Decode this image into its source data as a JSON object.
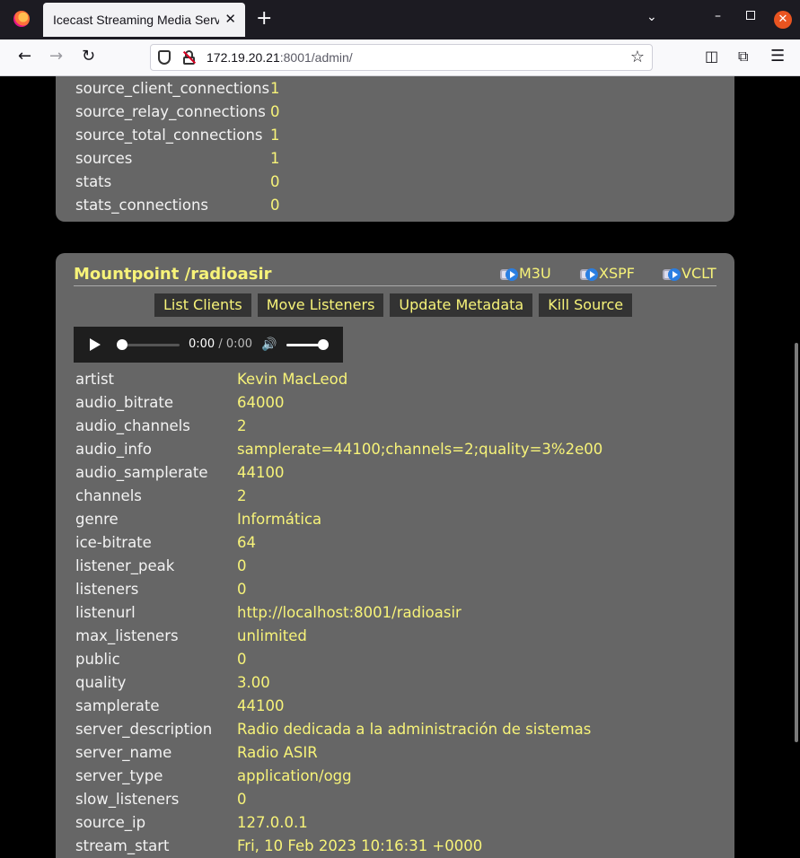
{
  "browser": {
    "tab_title": "Icecast Streaming Media Server",
    "tab_close": "✕",
    "new_tab": "+",
    "url_host": "172.19.20.21",
    "url_rest": ":8001/admin/"
  },
  "global_stats": [
    {
      "key": "source_client_connections",
      "value": "1"
    },
    {
      "key": "source_relay_connections",
      "value": "0"
    },
    {
      "key": "source_total_connections",
      "value": "1"
    },
    {
      "key": "sources",
      "value": "1"
    },
    {
      "key": "stats",
      "value": "0"
    },
    {
      "key": "stats_connections",
      "value": "0"
    }
  ],
  "mountpoint": {
    "title": "Mountpoint /radioasir",
    "playlists": [
      "M3U",
      "XSPF",
      "VCLT"
    ],
    "actions": [
      "List Clients",
      "Move Listeners",
      "Update Metadata",
      "Kill Source"
    ],
    "player": {
      "current": "0:00",
      "separator": " / ",
      "duration": "0:00"
    },
    "stats": [
      {
        "key": "artist",
        "value": "Kevin MacLeod"
      },
      {
        "key": "audio_bitrate",
        "value": "64000"
      },
      {
        "key": "audio_channels",
        "value": "2"
      },
      {
        "key": "audio_info",
        "value": "samplerate=44100;channels=2;quality=3%2e00"
      },
      {
        "key": "audio_samplerate",
        "value": "44100"
      },
      {
        "key": "channels",
        "value": "2"
      },
      {
        "key": "genre",
        "value": "Informática"
      },
      {
        "key": "ice-bitrate",
        "value": "64"
      },
      {
        "key": "listener_peak",
        "value": "0"
      },
      {
        "key": "listeners",
        "value": "0"
      },
      {
        "key": "listenurl",
        "value": "http://localhost:8001/radioasir"
      },
      {
        "key": "max_listeners",
        "value": "unlimited"
      },
      {
        "key": "public",
        "value": "0"
      },
      {
        "key": "quality",
        "value": "3.00"
      },
      {
        "key": "samplerate",
        "value": "44100"
      },
      {
        "key": "server_description",
        "value": "Radio dedicada a la administración de sistemas"
      },
      {
        "key": "server_name",
        "value": "Radio ASIR"
      },
      {
        "key": "server_type",
        "value": "application/ogg"
      },
      {
        "key": "slow_listeners",
        "value": "0"
      },
      {
        "key": "source_ip",
        "value": "127.0.0.1"
      },
      {
        "key": "stream_start",
        "value": "Fri, 10 Feb 2023 10:16:31 +0000"
      }
    ]
  }
}
